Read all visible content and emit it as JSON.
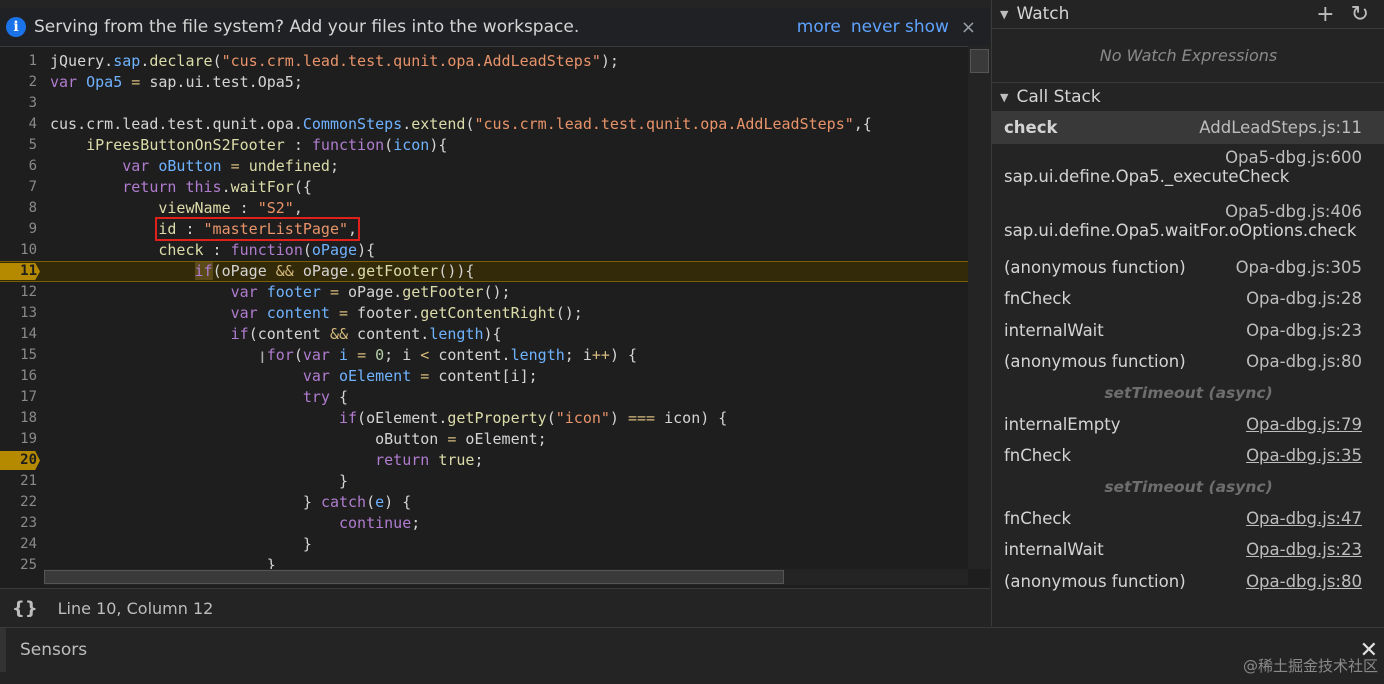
{
  "infobar": {
    "message": "Serving from the file system? Add your files into the workspace.",
    "more": "more",
    "never_show": "never show",
    "close": "×"
  },
  "code": {
    "lines": [
      {
        "n": "1"
      },
      {
        "n": "2"
      },
      {
        "n": "3"
      },
      {
        "n": "4"
      },
      {
        "n": "5"
      },
      {
        "n": "6"
      },
      {
        "n": "7"
      },
      {
        "n": "8"
      },
      {
        "n": "9"
      },
      {
        "n": "10"
      },
      {
        "n": "11"
      },
      {
        "n": "12"
      },
      {
        "n": "13"
      },
      {
        "n": "14"
      },
      {
        "n": "15"
      },
      {
        "n": "16"
      },
      {
        "n": "17"
      },
      {
        "n": "18"
      },
      {
        "n": "19"
      },
      {
        "n": "20"
      },
      {
        "n": "21"
      },
      {
        "n": "22"
      },
      {
        "n": "23"
      },
      {
        "n": "24"
      },
      {
        "n": "25"
      }
    ],
    "breakpoints": [
      "11",
      "20"
    ]
  },
  "status": {
    "braces": "{}",
    "position": "Line 10, Column 12"
  },
  "watch": {
    "title": "Watch",
    "add": "+",
    "refresh": "↻",
    "empty": "No Watch Expressions"
  },
  "call_stack": {
    "title": "Call Stack",
    "frames": [
      {
        "name": "check",
        "loc": "AddLeadSteps.js:11"
      },
      {
        "name": "sap.ui.define.Opa5._executeCheck",
        "loc": "Opa5-dbg.js:600"
      },
      {
        "name": "sap.ui.define.Opa5.waitFor.oOptions.check",
        "loc": "Opa5-dbg.js:406"
      },
      {
        "name": "(anonymous function)",
        "loc": "Opa-dbg.js:305"
      },
      {
        "name": "fnCheck",
        "loc": "Opa-dbg.js:28"
      },
      {
        "name": "internalWait",
        "loc": "Opa-dbg.js:23"
      },
      {
        "name": "(anonymous function)",
        "loc": "Opa-dbg.js:80"
      },
      {
        "async": "setTimeout (async)"
      },
      {
        "name": "internalEmpty",
        "loc": "Opa-dbg.js:79"
      },
      {
        "name": "fnCheck",
        "loc": "Opa-dbg.js:35"
      },
      {
        "async": "setTimeout (async)"
      },
      {
        "name": "fnCheck",
        "loc": "Opa-dbg.js:47"
      },
      {
        "name": "internalWait",
        "loc": "Opa-dbg.js:23"
      },
      {
        "name": "(anonymous function)",
        "loc": "Opa-dbg.js:80"
      }
    ]
  },
  "drawer": {
    "tab": "Sensors",
    "close": "✕",
    "watermark": "@稀土掘金技术社区"
  }
}
